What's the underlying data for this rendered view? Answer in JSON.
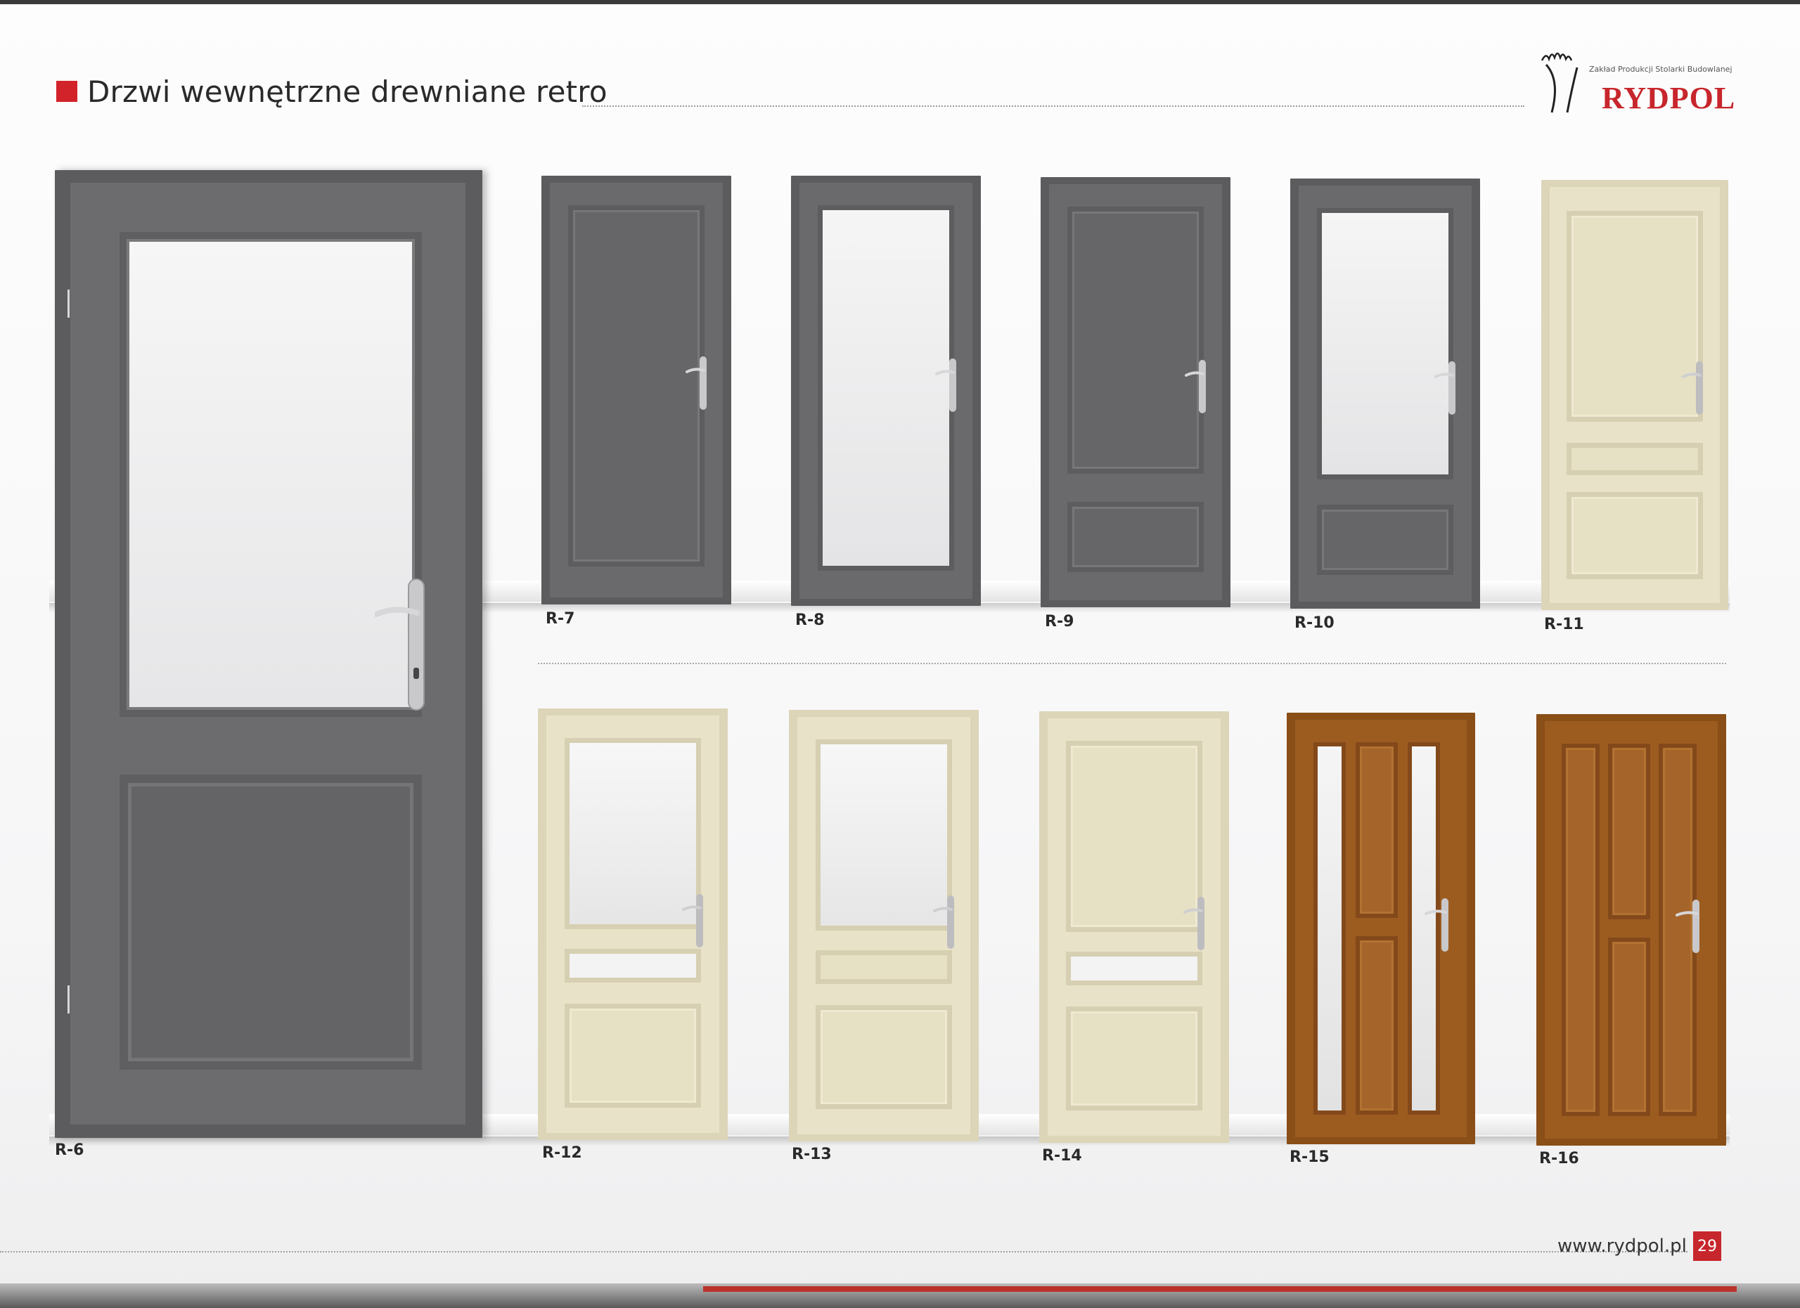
{
  "header": {
    "title": "Drzwi wewnętrzne drewniane retro",
    "accent_color": "#d2232a"
  },
  "brand": {
    "tagline": "Zakład Produkcji Stolarki Budowlanej",
    "name": "RYDPOL",
    "color": "#c7262c"
  },
  "colors": {
    "grey_door": "#6b6b6d",
    "cream_door": "#e8e2c8",
    "oak_door": "#9a5a1e"
  },
  "doors": [
    {
      "label": "R-6"
    },
    {
      "label": "R-7"
    },
    {
      "label": "R-8"
    },
    {
      "label": "R-9"
    },
    {
      "label": "R-10"
    },
    {
      "label": "R-11"
    },
    {
      "label": "R-12"
    },
    {
      "label": "R-13"
    },
    {
      "label": "R-14"
    },
    {
      "label": "R-15"
    },
    {
      "label": "R-16"
    }
  ],
  "footer": {
    "url": "www.rydpol.pl",
    "page_number": "29"
  }
}
